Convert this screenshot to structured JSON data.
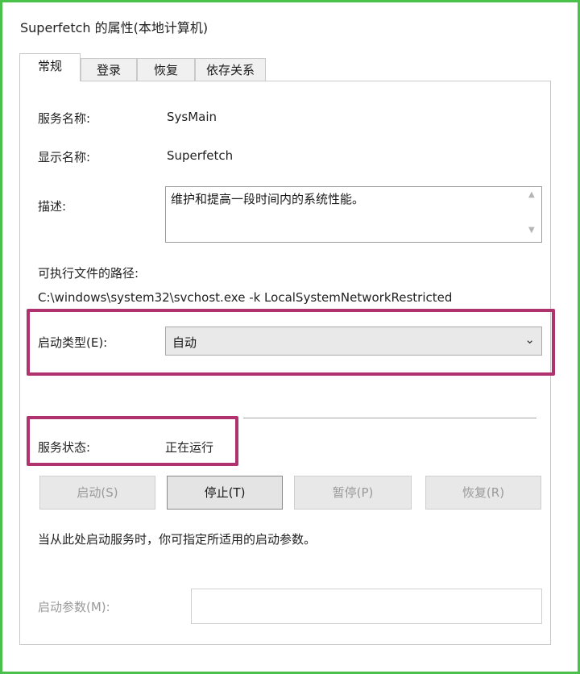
{
  "window": {
    "title": "Superfetch 的属性(本地计算机)"
  },
  "tabs": [
    {
      "label": "常规"
    },
    {
      "label": "登录"
    },
    {
      "label": "恢复"
    },
    {
      "label": "依存关系"
    }
  ],
  "general": {
    "service_name_label": "服务名称:",
    "service_name_value": "SysMain",
    "display_name_label": "显示名称:",
    "display_name_value": "Superfetch",
    "description_label": "描述:",
    "description_value": "维护和提高一段时间内的系统性能。",
    "exec_path_label": "可执行文件的路径:",
    "exec_path_value": "C:\\windows\\system32\\svchost.exe -k LocalSystemNetworkRestricted",
    "startup_type_label": "启动类型(E):",
    "startup_type_value": "自动",
    "service_status_label": "服务状态:",
    "service_status_value": "正在运行"
  },
  "buttons": {
    "start": "启动(S)",
    "stop": "停止(T)",
    "pause": "暂停(P)",
    "resume": "恢复(R)"
  },
  "hint": "当从此处启动服务时，你可指定所适用的启动参数。",
  "start_params": {
    "label": "启动参数(M):",
    "value": ""
  },
  "colors": {
    "frame": "#49c14a",
    "highlight": "#b0336f"
  }
}
